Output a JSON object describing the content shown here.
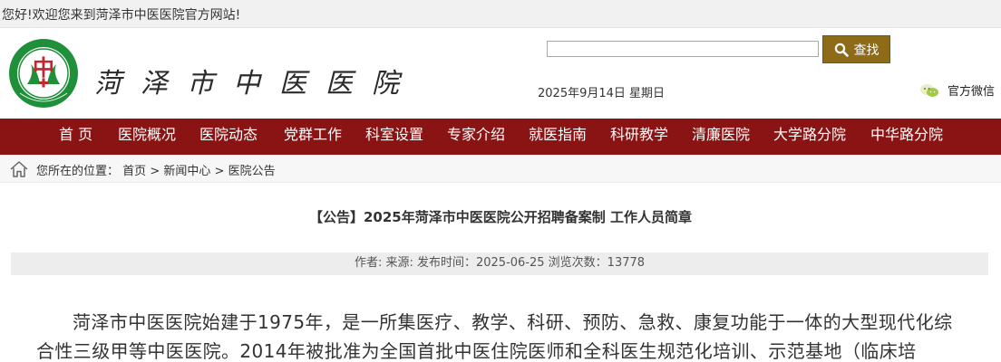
{
  "topbar": {
    "welcome": "您好!欢迎您来到菏泽市中医医院官方网站!"
  },
  "header": {
    "logo_name": "菏泽市中医医院",
    "logo_ring_text": "Heze Hospital of Traditional Chinese Medicine",
    "logo_glyph": "中",
    "search": {
      "value": "",
      "placeholder": "",
      "button_label": "查找",
      "icon": "search-icon"
    },
    "date": "2025年9月14日 星期日",
    "wechat": {
      "icon": "wechat-icon",
      "label": "官方微信"
    }
  },
  "nav": {
    "items": [
      {
        "label": "首 页"
      },
      {
        "label": "医院概况"
      },
      {
        "label": "医院动态"
      },
      {
        "label": "党群工作"
      },
      {
        "label": "科室设置"
      },
      {
        "label": "专家介绍"
      },
      {
        "label": "就医指南"
      },
      {
        "label": "科研教学"
      },
      {
        "label": "清廉医院"
      },
      {
        "label": "大学路分院"
      },
      {
        "label": "中华路分院"
      }
    ]
  },
  "breadcrumb": {
    "icon": "home-icon",
    "prefix": "您所在的位置：",
    "crumbs": [
      "首页",
      "新闻中心",
      "医院公告"
    ],
    "separator": ">"
  },
  "article": {
    "title": "【公告】2025年菏泽市中医医院公开招聘备案制 工作人员简章",
    "meta": "作者:   来源:   发布时间：2025-06-25 浏览次数：13778",
    "body": "菏泽市中医医院始建于1975年，是一所集医疗、教学、科研、预防、急救、康复功能于一体的大型现代化综合性三级甲等中医医院。2014年被批准为全国首批中医住院医师和全科医生规范化培训、示范基地（临床培"
  },
  "colors": {
    "nav_background": "#8a1313",
    "search_button": "#8e6b18",
    "logo_green": "#1f8f3a",
    "logo_red": "#c1272d"
  }
}
